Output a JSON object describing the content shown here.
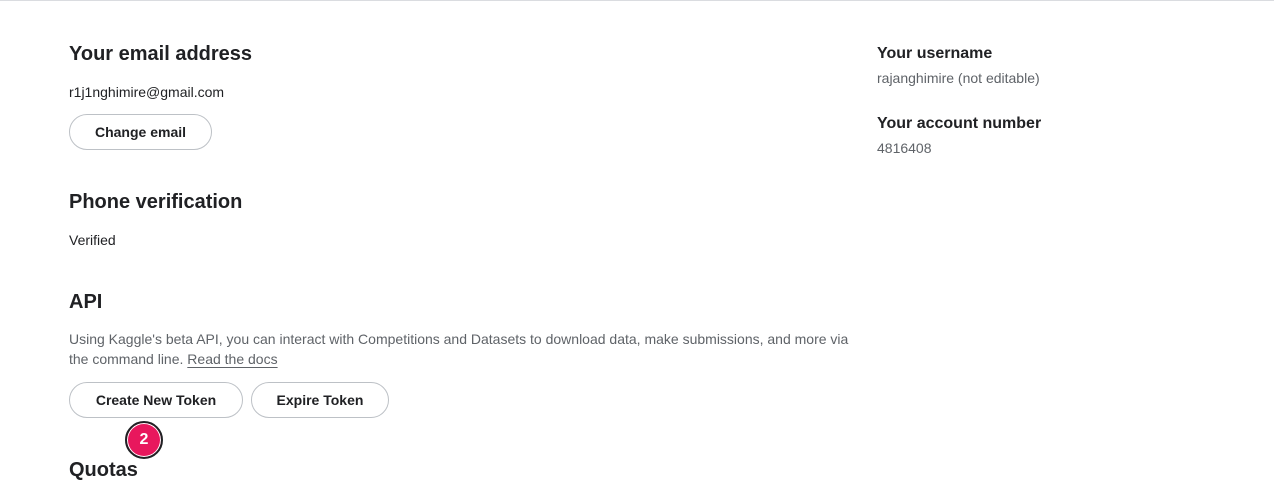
{
  "email_section": {
    "title": "Your email address",
    "email": "r1j1nghimire@gmail.com",
    "change_button": "Change email"
  },
  "phone_section": {
    "title": "Phone verification",
    "status": "Verified"
  },
  "api_section": {
    "title": "API",
    "description": "Using Kaggle's beta API, you can interact with Competitions and Datasets to download data, make submissions, and more via the command line.",
    "docs_link": "Read the docs",
    "create_button": "Create New Token",
    "expire_button": "Expire Token",
    "step_badge": "2"
  },
  "quotas_section": {
    "title": "Quotas"
  },
  "sidebar": {
    "username_title": "Your username",
    "username_value": "rajanghimire (not editable)",
    "account_title": "Your account number",
    "account_value": "4816408"
  },
  "colors": {
    "badge": "#e8175d",
    "text_primary": "#202124",
    "text_muted": "#5f6368",
    "button_border": "#bdc1c6"
  }
}
